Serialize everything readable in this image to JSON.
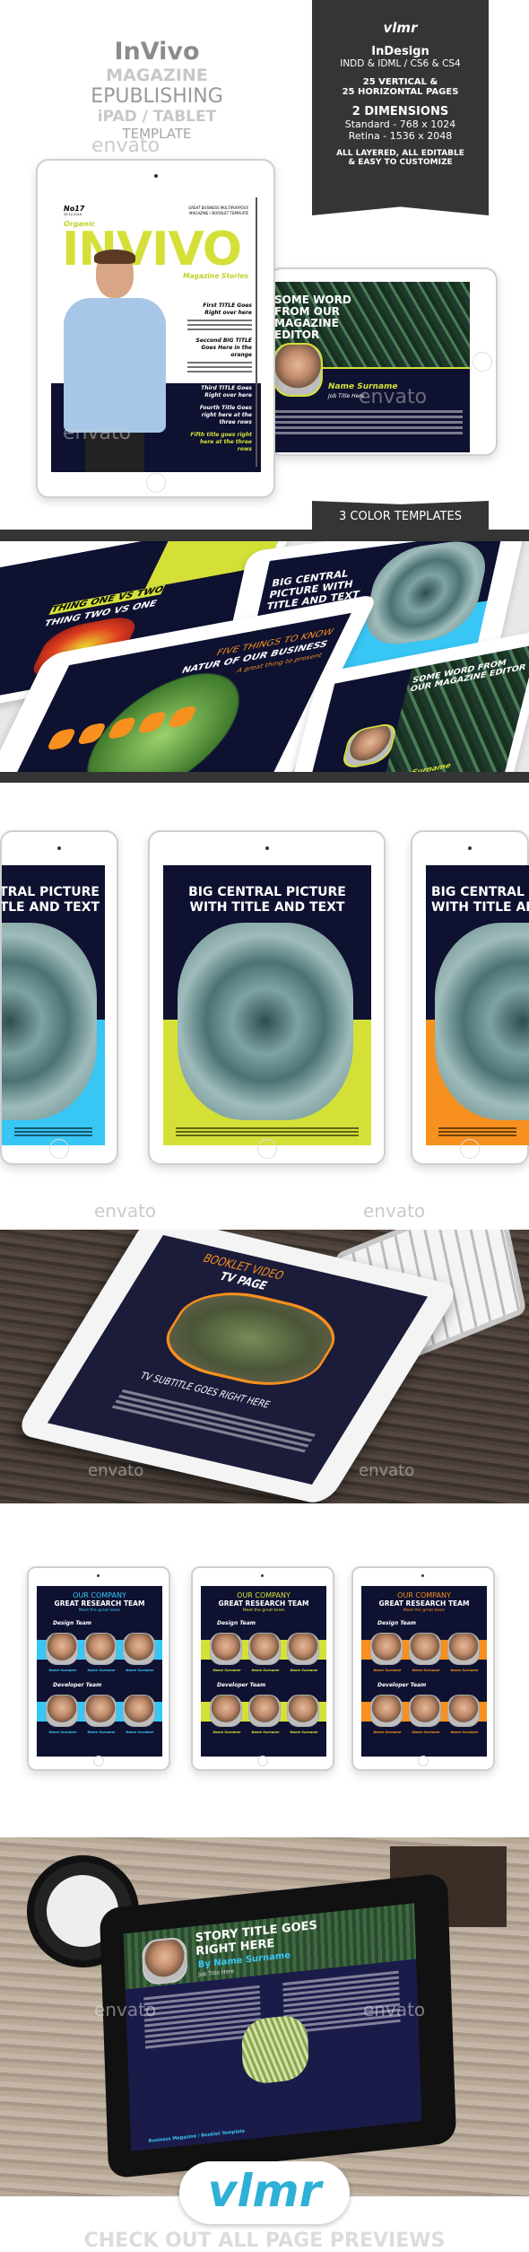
{
  "hero": {
    "title": "InVivo",
    "l2": "MAGAZINE",
    "l3": "EPUBLISHING",
    "l4": "iPAD / TABLET",
    "l5": "TEMPLATE"
  },
  "watermark": "envato",
  "info": {
    "logo": "vlmr",
    "software": "InDesign",
    "formats": "INDD & IDML / CS6 & CS4",
    "pages1": "25 VERTICAL &",
    "pages2": "25 HORIZONTAL PAGES",
    "dims": "2 DIMENSIONS",
    "standard": "Standard - 768 x 1024",
    "retina": "Retina - 1536 x 2048",
    "edit1": "ALL LAYERED, ALL EDITABLE",
    "edit2": "& EASY TO CUSTOMIZE"
  },
  "color_templates": "3 COLOR TEMPLATES",
  "cover": {
    "issue": "No17",
    "date": "25.12.2015",
    "tagline1": "GREAT BUSINESS MULTIPURPOUS",
    "tagline2": "MAGAZINE / BOOKLET TEMPLATE",
    "kicker": "Organic",
    "masthead": "INVIVO",
    "sub": "Magazine Stories",
    "headlines": [
      "First TITLE Goes Right over here",
      "Seccond BIG TITLE Goes Here in the orange",
      "Third TITLE Goes Right over here",
      "Fourth Title Goes right here at the three rows",
      "Fifth title goes right here at the three rows"
    ]
  },
  "editor": {
    "title": "SOME WORD FROM OUR MAGAZINE EDITOR",
    "name": "Name Surname",
    "job": "Job Title Here"
  },
  "perspective": {
    "p1": "THING ONE VS TWO",
    "p1b": "THING TWO VS ONE",
    "p2": "BIG CENTRAL PICTURE WITH TITLE AND TEXT",
    "p3a": "FIVE THINGS TO KNOW",
    "p3b": "NATUR OF OUR BUSINESS",
    "p3c": "A great thing to present",
    "p4": "SOME WORD FROM OUR MAGAZINE EDITOR",
    "p4name": "Name Surname"
  },
  "central": {
    "title1": "BIG CENTRAL PICTURE",
    "title2": "WITH TITLE AND TEXT"
  },
  "colors": {
    "blue": "#38c6f4",
    "lime": "#d4e038",
    "orange": "#f7901e",
    "navy": "#0e1130",
    "dark": "#353535"
  },
  "tv": {
    "t1": "BOOKLET VIDEO",
    "t2": "TV PAGE",
    "subtitle": "TV SUBTITLE GOES RIGHT HERE"
  },
  "team": {
    "t1": "OUR COMPANY",
    "t2": "GREAT RESEARCH TEAM",
    "t3": "Meet the great team",
    "design": "Design Team",
    "dev": "Developer Team",
    "name": "Name Surname",
    "job": "Job Title Here"
  },
  "story": {
    "t1": "STORY TITLE GOES",
    "t2": "RIGHT HERE",
    "by": "By Name Surname",
    "job": "Job Title Here",
    "footer": "Business Magazine / Booklet Template"
  },
  "cta": "CHECK OUT ALL PAGE PREVIEWS"
}
